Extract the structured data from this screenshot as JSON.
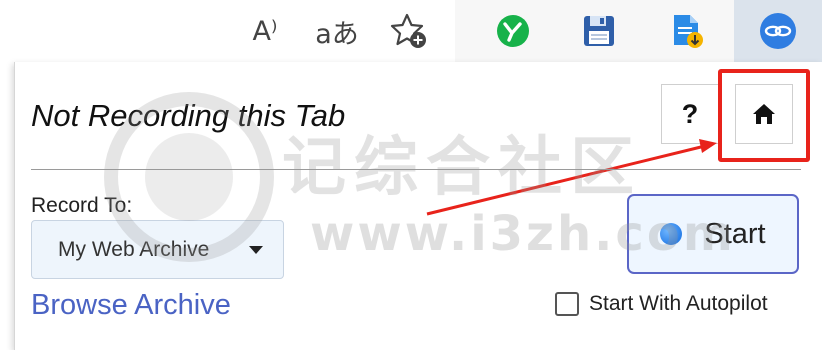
{
  "toolbar": {
    "read_aloud_icon": "A⁾",
    "translate_icon": "aあ",
    "icons": {
      "read_aloud": "read-aloud-icon",
      "translate": "translate-icon",
      "favorite": "favorite-add-icon",
      "ext_green": "green-y-extension-icon",
      "ext_save": "floppy-save-icon",
      "ext_doc": "document-download-icon",
      "ext_webrecorder": "webrecorder-chain-icon"
    }
  },
  "popup": {
    "status": "Not Recording this Tab",
    "help_label": "?",
    "record_to_label": "Record To:",
    "archive_selected": "My Web Archive",
    "browse_link": "Browse Archive",
    "start_label": "Start",
    "autopilot_label": "Start With Autopilot",
    "autopilot_checked": false
  },
  "watermark": {
    "text": "记综合社区",
    "url": "www.i3zh.com"
  },
  "colors": {
    "accent_blue": "#4a63c4",
    "start_border": "#5b66c7",
    "highlight_red": "#e8231b",
    "active_ext_bg": "#dbe3ec"
  }
}
